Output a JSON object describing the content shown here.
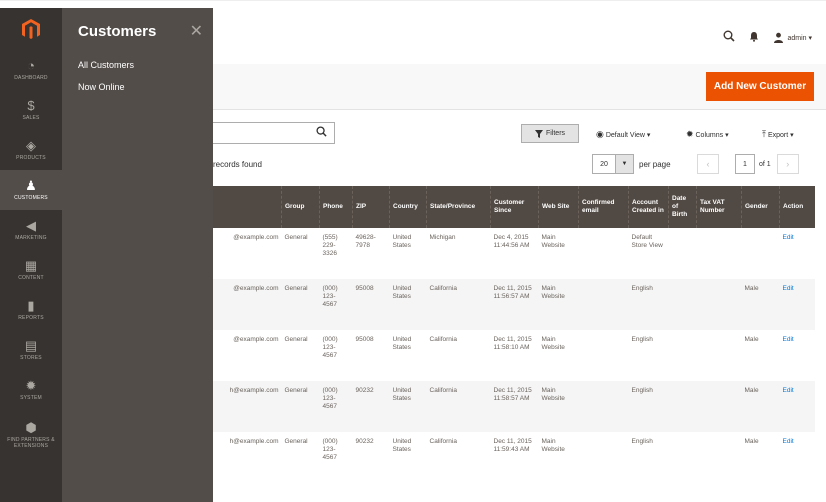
{
  "rail": {
    "items": [
      {
        "icon": "dashboard-icon",
        "label": "DASHBOARD"
      },
      {
        "icon": "dollar-icon",
        "label": "SALES"
      },
      {
        "icon": "box-icon",
        "label": "PRODUCTS"
      },
      {
        "icon": "person-icon",
        "label": "CUSTOMERS"
      },
      {
        "icon": "megaphone-icon",
        "label": "MARKETING"
      },
      {
        "icon": "content-icon",
        "label": "CONTENT"
      },
      {
        "icon": "bar-chart-icon",
        "label": "REPORTS"
      },
      {
        "icon": "store-icon",
        "label": "STORES"
      },
      {
        "icon": "gear-icon",
        "label": "SYSTEM"
      },
      {
        "icon": "partners-icon",
        "label": "FIND PARTNERS & EXTENSIONS"
      }
    ]
  },
  "flyout": {
    "title": "Customers",
    "close": "✕",
    "items": [
      "All Customers",
      "Now Online"
    ]
  },
  "header": {
    "admin": "admin ▾"
  },
  "actions": {
    "add": "Add New Customer",
    "filters": "Filters",
    "view": "Default View ▾",
    "columns": "Columns ▾",
    "export": "Export ▾"
  },
  "records": "records found",
  "paging": {
    "per_page_value": "20",
    "per_page_label": "per page",
    "page": "1",
    "of": "of 1"
  },
  "table": {
    "headers": [
      "",
      "Group",
      "Phone",
      "ZIP",
      "Country",
      "State/Province",
      "Customer Since",
      "Web Site",
      "Confirmed email",
      "Account Created in",
      "Date of Birth",
      "Tax VAT Number",
      "Gender",
      "Action"
    ],
    "rows": [
      [
        "@example.com",
        "General",
        "(555) 229-3326",
        "49628-7978",
        "United States",
        "Michigan",
        "Dec 4, 2015 11:44:56 AM",
        "Main Website",
        "",
        "Default Store View",
        "",
        "",
        "",
        "Edit"
      ],
      [
        "@example.com",
        "General",
        "(000) 123-4567",
        "95008",
        "United States",
        "California",
        "Dec 11, 2015 11:56:57 AM",
        "Main Website",
        "",
        "English",
        "",
        "",
        "Male",
        "Edit"
      ],
      [
        "@example.com",
        "General",
        "(000) 123-4567",
        "95008",
        "United States",
        "California",
        "Dec 11, 2015 11:58:10 AM",
        "Main Website",
        "",
        "English",
        "",
        "",
        "Male",
        "Edit"
      ],
      [
        "h@example.com",
        "General",
        "(000) 123-4567",
        "90232",
        "United States",
        "California",
        "Dec 11, 2015 11:58:57 AM",
        "Main Website",
        "",
        "English",
        "",
        "",
        "Male",
        "Edit"
      ],
      [
        "h@example.com",
        "General",
        "(000) 123-4567",
        "90232",
        "United States",
        "California",
        "Dec 11, 2015 11:59:43 AM",
        "Main Website",
        "",
        "English",
        "",
        "",
        "Male",
        "Edit"
      ]
    ]
  }
}
